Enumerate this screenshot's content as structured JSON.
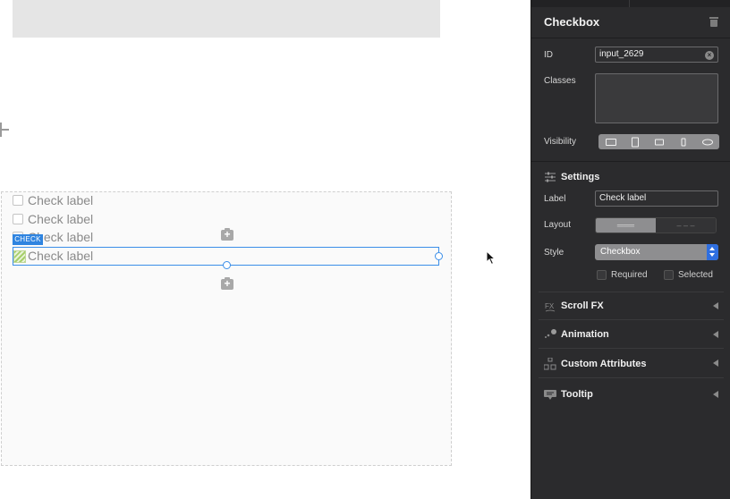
{
  "canvas": {
    "check_tag": "CHECK",
    "checkboxes": [
      {
        "label": "Check label"
      },
      {
        "label": "Check label"
      },
      {
        "label": "Check label"
      },
      {
        "label": "Check label"
      }
    ]
  },
  "panel": {
    "title": "Checkbox",
    "id_label": "ID",
    "id_value": "input_2629",
    "classes_label": "Classes",
    "classes_value": "",
    "visibility_label": "Visibility",
    "visibility_icons": [
      "desktop-icon",
      "tablet-icon",
      "tablet-landscape-icon",
      "phone-icon",
      "eye-icon"
    ],
    "settings": {
      "title": "Settings",
      "label_label": "Label",
      "label_value": "Check label",
      "layout_label": "Layout",
      "layout_option_on": "═══",
      "layout_option_off": "– – –",
      "style_label": "Style",
      "style_value": "Checkbox",
      "required_label": "Required",
      "selected_label": "Selected"
    },
    "sections": [
      {
        "title": "Scroll FX",
        "icon": "fx-icon"
      },
      {
        "title": "Animation",
        "icon": "animation-icon"
      },
      {
        "title": "Custom Attributes",
        "icon": "attributes-icon"
      },
      {
        "title": "Tooltip",
        "icon": "tooltip-icon"
      }
    ],
    "accent_color": "#2f6fe0",
    "selection_color": "#3b8ee8"
  }
}
